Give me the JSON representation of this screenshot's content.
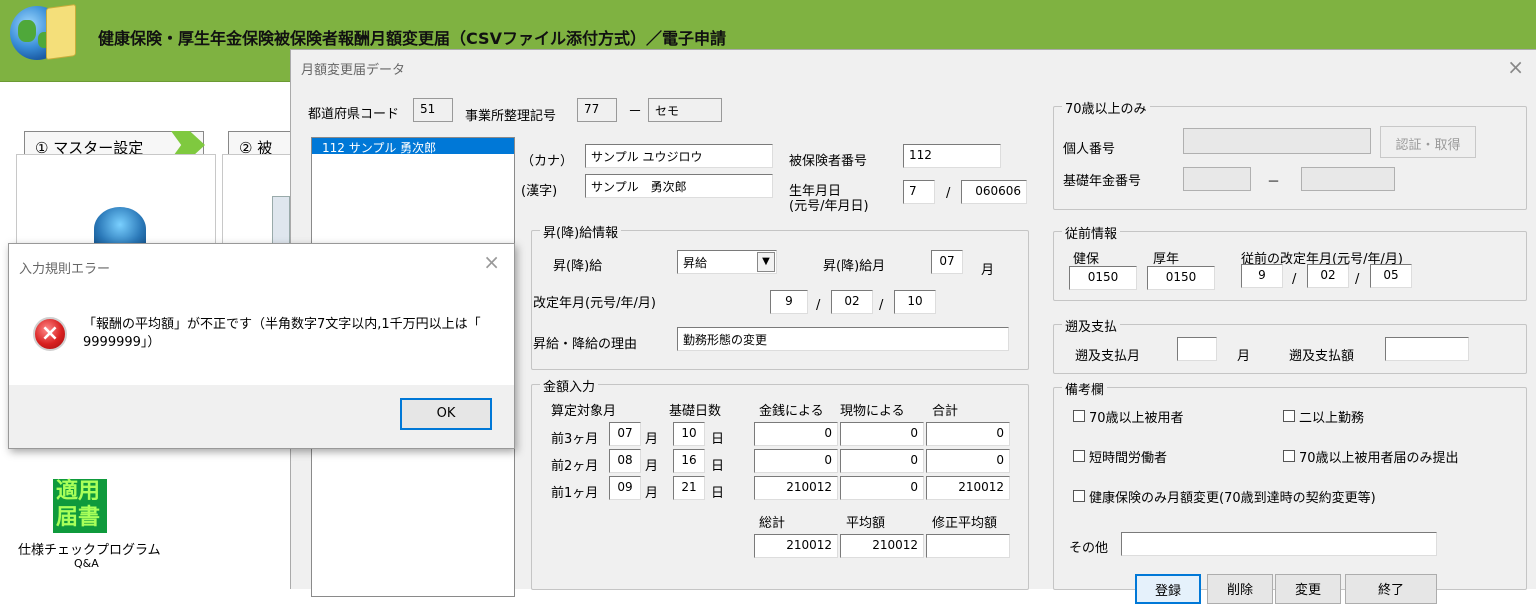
{
  "app": {
    "title": "健康保険・厚生年金保険被保険者報酬月額変更届（CSVファイル添付方式）／電子申請"
  },
  "menu": {
    "step1": "① マスター設定",
    "step2": "② 被",
    "tekiyo_top": "適用",
    "tekiyo_bottom": "届書",
    "spec_check": "仕様チェックプログラム",
    "qa": "Q&A"
  },
  "dialog": {
    "title": "月額変更届データ",
    "close": "×",
    "header": {
      "pref_label": "都道府県コード",
      "pref_value": "51",
      "office_label": "事業所整理記号",
      "office_value1": "77",
      "dash": "－",
      "office_value2": "セモ"
    },
    "list": {
      "selected": "112    サンプル 勇次郎"
    },
    "person": {
      "kana_label": "（カナ）",
      "kana_value": "サンプル ユウジロウ",
      "kanji_label": "(漢字)",
      "kanji_value": "サンプル　勇次郎",
      "insured_no_label": "被保険者番号",
      "insured_no_value": "112",
      "birth_label1": "生年月日",
      "birth_label2": "(元号/年月日)",
      "birth_era": "7",
      "slash": "/",
      "birth_date": "060606"
    },
    "promotion": {
      "group": "昇(降)給情報",
      "type_label": "昇(降)給",
      "type_value": "昇給",
      "dropdown_arrow": "▼",
      "month_label": "昇(降)給月",
      "month_value": "07",
      "month_unit": "月",
      "rev_label": "改定年月(元号/年/月)",
      "rev_era": "9",
      "rev_year": "02",
      "rev_month": "10",
      "reason_label": "昇給・降給の理由",
      "reason_value": "勤務形態の変更"
    },
    "amount": {
      "group": "金額入力",
      "h_month": "算定対象月",
      "h_days": "基礎日数",
      "h_money": "金銭による",
      "h_kind": "現物による",
      "h_total": "合計",
      "rows": [
        {
          "label": "前3ヶ月",
          "month": "07",
          "m_unit": "月",
          "days": "10",
          "d_unit": "日",
          "money": "0",
          "kind": "0",
          "total": "0"
        },
        {
          "label": "前2ヶ月",
          "month": "08",
          "m_unit": "月",
          "days": "16",
          "d_unit": "日",
          "money": "0",
          "kind": "0",
          "total": "0"
        },
        {
          "label": "前1ヶ月",
          "month": "09",
          "m_unit": "月",
          "days": "21",
          "d_unit": "日",
          "money": "210012",
          "kind": "0",
          "total": "210012"
        }
      ],
      "sum_label": "総計",
      "avg_label": "平均額",
      "mod_label": "修正平均額",
      "sum_value": "210012",
      "avg_value": "210012",
      "mod_value": ""
    },
    "over70": {
      "group": "70歳以上のみ",
      "personal_no_label": "個人番号",
      "auth_button": "認証・取得",
      "pension_no_label": "基礎年金番号",
      "dash": "－"
    },
    "previous": {
      "group": "従前情報",
      "health_label": "健保",
      "health_value": "0150",
      "pension_label": "厚年",
      "pension_value": "0150",
      "rev_label": "従前の改定年月(元号/年/月)",
      "rev_era": "9",
      "rev_year": "02",
      "rev_month": "05"
    },
    "retro": {
      "group": "遡及支払",
      "month_label": "遡及支払月",
      "month_unit": "月",
      "amount_label": "遡及支払額"
    },
    "remarks": {
      "group": "備考欄",
      "cb1": "70歳以上被用者",
      "cb2": "二以上勤務",
      "cb3": "短時間労働者",
      "cb4": "70歳以上被用者届のみ提出",
      "cb5": "健康保険のみ月額変更(70歳到達時の契約変更等)",
      "other_label": "その他"
    },
    "buttons": {
      "register": "登録",
      "delete": "削除",
      "change": "変更",
      "quit": "終了"
    }
  },
  "error": {
    "title": "入力規則エラー",
    "close": "×",
    "line1": "「報酬の平均額」が不正です（半角数字7文字以内,1千万円以上は「",
    "line2": "9999999」）",
    "ok": "OK",
    "icon": "×"
  }
}
